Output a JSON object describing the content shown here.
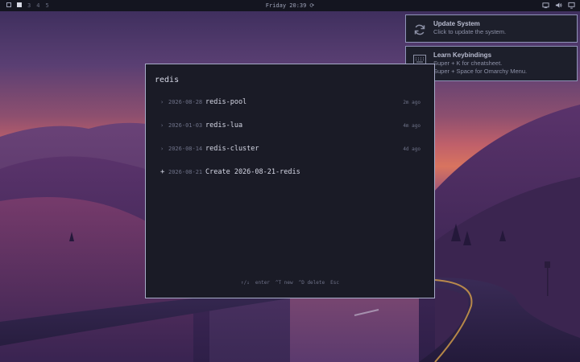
{
  "colors": {
    "bar_bg": "#141520",
    "panel_bg": "#1a1b26",
    "panel_border": "#a7abc8",
    "text_primary": "#d6d8e6",
    "text_muted": "#6e7288",
    "notif_border": "#8f93b8"
  },
  "topbar": {
    "workspaces": [
      {
        "label": "",
        "icon": "square-outline-icon",
        "active": true
      },
      {
        "label": "",
        "icon": "square-filled-icon",
        "active": true
      },
      {
        "label": "3",
        "active": false
      },
      {
        "label": "4",
        "active": false
      },
      {
        "label": "5",
        "active": false
      }
    ],
    "clock": "Friday 20:39",
    "clock_icon": "spinner-icon",
    "tray": [
      "screen-icon",
      "volume-icon",
      "monitor-icon"
    ]
  },
  "notifications": [
    {
      "title": "Update System",
      "body": [
        "Click to update the system."
      ],
      "icon": "refresh-icon"
    },
    {
      "title": "Learn Keybindings",
      "body": [
        "Super + K for cheatsheet.",
        "Super + Space for Omarchy Menu."
      ],
      "icon": "keyboard-icon"
    }
  ],
  "launcher": {
    "query": "redis",
    "results": [
      {
        "marker": "›",
        "date": "2026-08-28",
        "name": "redis-pool",
        "age": "2m ago"
      },
      {
        "marker": "›",
        "date": "2026-01-03",
        "name": "redis-lua",
        "age": "4m ago"
      },
      {
        "marker": "›",
        "date": "2026-08-14",
        "name": "redis-cluster",
        "age": "4d ago"
      }
    ],
    "create": {
      "marker": "+",
      "date": "2026-08-21",
      "label": "Create 2026-08-21-redis"
    },
    "hints": [
      "↑/↓",
      "enter",
      "^T new",
      "^D delete",
      "Esc"
    ]
  }
}
